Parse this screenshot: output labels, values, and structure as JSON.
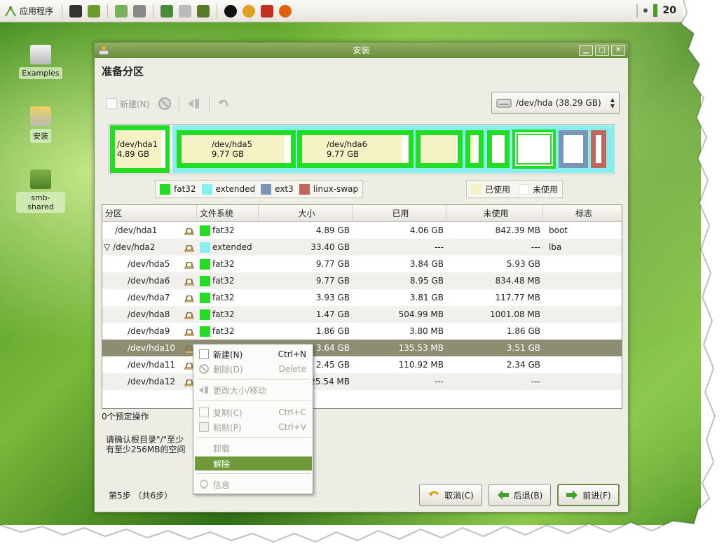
{
  "panel": {
    "apps_menu_label": "应用程序",
    "clock": "20"
  },
  "desktop_icons": [
    {
      "label": "Examples",
      "icon": "folder-icon"
    },
    {
      "label": "安装",
      "icon": "installer-icon"
    },
    {
      "label": "smb-shared",
      "icon": "folder-icon"
    }
  ],
  "window": {
    "title": "安装",
    "heading": "准备分区",
    "toolbar": {
      "new_label": "新建(N)"
    },
    "device": "/dev/hda  (38.29 GB)",
    "partition_map": [
      {
        "label": "/dev/hda1",
        "size": "4.89 GB"
      },
      {
        "label": "/dev/hda5",
        "size": "9.77 GB"
      },
      {
        "label": "/dev/hda6",
        "size": "9.77 GB"
      }
    ],
    "legend_types": [
      {
        "name": "fat32",
        "color": "#22dd22"
      },
      {
        "name": "extended",
        "color": "#88eeee"
      },
      {
        "name": "ext3",
        "color": "#7b95b9"
      },
      {
        "name": "linux-swap",
        "color": "#c1665b"
      }
    ],
    "legend_usage": [
      {
        "name": "已使用",
        "color": "#f5f3c6"
      },
      {
        "name": "未使用",
        "color": "#ffffff"
      }
    ],
    "table": {
      "headers": [
        "分区",
        "文件系统",
        "大小",
        "已用",
        "未使用",
        "标志"
      ],
      "rows": [
        {
          "partition": "/dev/hda1",
          "fs": "fat32",
          "fs_color": "#22dd22",
          "size": "4.89 GB",
          "used": "4.06 GB",
          "unused": "842.39 MB",
          "flag": "boot",
          "indent": 1
        },
        {
          "partition": "/dev/hda2",
          "fs": "extended",
          "fs_color": "#88eeee",
          "size": "33.40 GB",
          "used": "---",
          "unused": "---",
          "flag": "lba",
          "indent": 0
        },
        {
          "partition": "/dev/hda5",
          "fs": "fat32",
          "fs_color": "#22dd22",
          "size": "9.77 GB",
          "used": "3.84 GB",
          "unused": "5.93 GB",
          "flag": "",
          "indent": 2
        },
        {
          "partition": "/dev/hda6",
          "fs": "fat32",
          "fs_color": "#22dd22",
          "size": "9.77 GB",
          "used": "8.95 GB",
          "unused": "834.48 MB",
          "flag": "",
          "indent": 2
        },
        {
          "partition": "/dev/hda7",
          "fs": "fat32",
          "fs_color": "#22dd22",
          "size": "3.93 GB",
          "used": "3.81 GB",
          "unused": "117.77 MB",
          "flag": "",
          "indent": 2
        },
        {
          "partition": "/dev/hda8",
          "fs": "fat32",
          "fs_color": "#22dd22",
          "size": "1.47 GB",
          "used": "504.99 MB",
          "unused": "1001.08 MB",
          "flag": "",
          "indent": 2
        },
        {
          "partition": "/dev/hda9",
          "fs": "fat32",
          "fs_color": "#22dd22",
          "size": "1.86 GB",
          "used": "3.80 MB",
          "unused": "1.86 GB",
          "flag": "",
          "indent": 2
        },
        {
          "partition": "/dev/hda10",
          "fs": "",
          "fs_color": "",
          "size": "3.64 GB",
          "used": "135.53 MB",
          "unused": "3.51 GB",
          "flag": "",
          "indent": 2,
          "selected": true
        },
        {
          "partition": "/dev/hda11",
          "fs": "",
          "fs_color": "",
          "size": "2.45 GB",
          "used": "110.92 MB",
          "unused": "2.34 GB",
          "flag": "",
          "indent": 2
        },
        {
          "partition": "/dev/hda12",
          "fs": "",
          "fs_color": "",
          "size": "25.54 MB",
          "used": "---",
          "unused": "---",
          "flag": "",
          "indent": 2
        }
      ]
    },
    "pending_ops": "0个预定操作",
    "warning": "请确认根目录\"/\"至少有至少256MB的空间",
    "warning_line1": "请确认根目录\"/\"至少",
    "warning_line2": "有至少256MB的空间",
    "step": "第5步 （共6步）",
    "buttons": {
      "cancel": "取消(C)",
      "back": "后退(B)",
      "forward": "前进(F)"
    }
  },
  "context_menu": {
    "items": [
      {
        "label": "新建(N)",
        "accel": "Ctrl+N",
        "enabled": true
      },
      {
        "label": "删除(D)",
        "accel": "Delete",
        "enabled": false
      },
      {
        "label": "更改大小/移动",
        "accel": "",
        "enabled": false
      },
      {
        "label": "复制(C)",
        "accel": "Ctrl+C",
        "enabled": false
      },
      {
        "label": "粘贴(P)",
        "accel": "Ctrl+V",
        "enabled": false
      },
      {
        "label": "卸载",
        "accel": "",
        "enabled": false
      },
      {
        "label": "解除",
        "accel": "",
        "enabled": true,
        "highlighted": true
      },
      {
        "label": "信息",
        "accel": "",
        "enabled": false
      }
    ]
  }
}
